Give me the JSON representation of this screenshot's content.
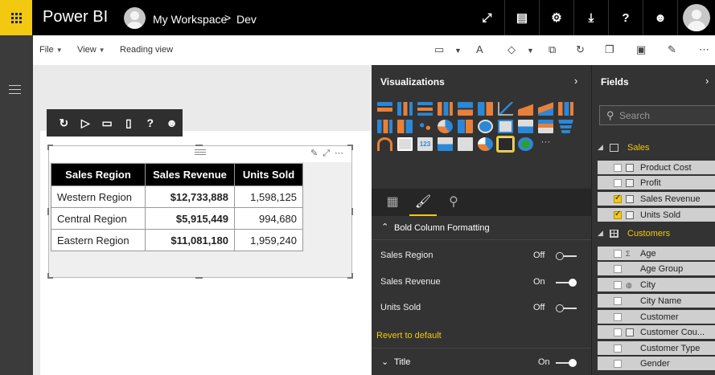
{
  "app": {
    "title": "Power BI"
  },
  "breadcrumb": {
    "workspace": "My Workspace",
    "separator": ">",
    "report": "Dev"
  },
  "menu": {
    "file": "File",
    "view": "View",
    "reading_view": "Reading view"
  },
  "table": {
    "headers": [
      "Sales Region",
      "Sales Revenue",
      "Units Sold"
    ],
    "rows": [
      [
        "Western Region",
        "$12,733,888",
        "1,598,125"
      ],
      [
        "Central Region",
        "$5,915,449",
        "994,680"
      ],
      [
        "Eastern Region",
        "$11,081,180",
        "1,959,240"
      ]
    ]
  },
  "viz_pane": {
    "title": "Visualizations",
    "section": "Bold Column Formatting",
    "rows": [
      {
        "label": "Sales Region",
        "state": "Off"
      },
      {
        "label": "Sales Revenue",
        "state": "On"
      },
      {
        "label": "Units Sold",
        "state": "Off"
      }
    ],
    "revert": "Revert to default",
    "title_row": {
      "label": "Title",
      "state": "On"
    },
    "more_glyph": "···"
  },
  "fields_pane": {
    "title": "Fields",
    "search_placeholder": "Search",
    "groups": [
      {
        "name": "Sales",
        "fields": [
          {
            "label": "Product Cost",
            "checked": false,
            "icon": "calculator-icon"
          },
          {
            "label": "Profit",
            "checked": false,
            "icon": "calculator-icon"
          },
          {
            "label": "Sales Revenue",
            "checked": true,
            "icon": "calculator-icon"
          },
          {
            "label": "Units Sold",
            "checked": true,
            "icon": "calculator-icon"
          }
        ]
      },
      {
        "name": "Customers",
        "fields": [
          {
            "label": "Age",
            "checked": false,
            "icon": "sigma-icon"
          },
          {
            "label": "Age Group",
            "checked": false,
            "icon": ""
          },
          {
            "label": "City",
            "checked": false,
            "icon": "globe-icon"
          },
          {
            "label": "City Name",
            "checked": false,
            "icon": ""
          },
          {
            "label": "Customer",
            "checked": false,
            "icon": ""
          },
          {
            "label": "Customer Cou...",
            "checked": false,
            "icon": "calculator-icon"
          },
          {
            "label": "Customer Type",
            "checked": false,
            "icon": ""
          },
          {
            "label": "Gender",
            "checked": false,
            "icon": ""
          }
        ]
      }
    ]
  },
  "colors": {
    "accent": "#f2c811",
    "topbar": "#000000",
    "pane": "#333333"
  }
}
